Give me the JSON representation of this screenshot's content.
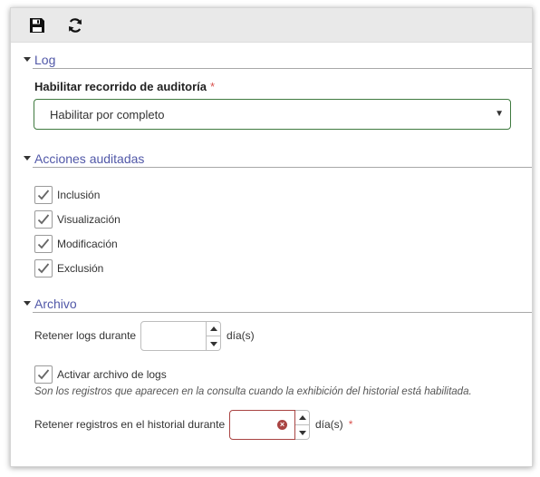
{
  "toolbar": {
    "save_icon": "floppy-disk-icon",
    "refresh_icon": "refresh-icon"
  },
  "log": {
    "title": "Log",
    "audit_label": "Habilitar recorrido de auditoría",
    "required_mark": "*",
    "audit_select_value": "Habilitar por completo"
  },
  "actions": {
    "title": "Acciones auditadas",
    "items": [
      {
        "label": "Inclusión",
        "checked": true
      },
      {
        "label": "Visualización",
        "checked": true
      },
      {
        "label": "Modificación",
        "checked": true
      },
      {
        "label": "Exclusión",
        "checked": true
      }
    ]
  },
  "archive": {
    "title": "Archivo",
    "retain_logs_label": "Retener logs durante",
    "retain_logs_value": "",
    "retain_logs_unit": "día(s)",
    "activate_archive_label": "Activar archivo de logs",
    "activate_archive_checked": true,
    "help_text": "Son los registros que aparecen en la consulta cuando la exhibición del historial está habilitada.",
    "retain_history_label": "Retener registros en el historial durante",
    "retain_history_value": "",
    "retain_history_unit": "día(s)",
    "required_mark": "*"
  },
  "colors": {
    "section_title": "#5158a8",
    "required": "#d9534f",
    "error_border": "#a94442",
    "select_border": "#3f7a3f"
  }
}
